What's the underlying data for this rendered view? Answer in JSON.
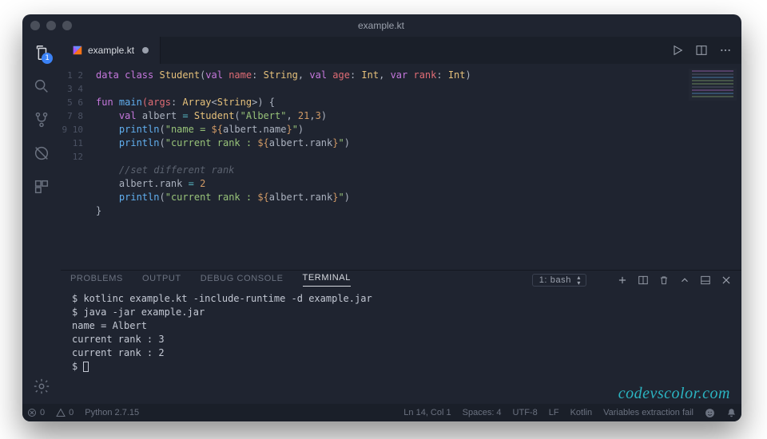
{
  "window": {
    "title": "example.kt"
  },
  "activitybar": {
    "badge": "1"
  },
  "tabs": [
    {
      "label": "example.kt",
      "dirty": true
    }
  ],
  "editor": {
    "line_start": 1,
    "lines": {
      "l1": {
        "a": "data class ",
        "b": "Student",
        "c": "(",
        "d": "val",
        "e": " name",
        "f": ": ",
        "g": "String",
        "h": ", ",
        "i": "val",
        "j": " age",
        "k": ": ",
        "l": "Int",
        "m": ", ",
        "n": "var",
        "o": " rank",
        "p": ": ",
        "q": "Int",
        "r": ")"
      },
      "l3": {
        "a": "fun ",
        "b": "main",
        "c": "(args",
        "d": ": ",
        "e": "Array",
        "f": "<",
        "g": "String",
        "h": ">) {"
      },
      "l4": {
        "ind": "    ",
        "a": "val",
        "b": " albert ",
        "c": "= ",
        "d": "Student",
        "e": "(",
        "f": "\"Albert\"",
        "g": ", ",
        "h": "21",
        "i": ",",
        "j": "3",
        "k": ")"
      },
      "l5": {
        "ind": "    ",
        "a": "println",
        "b": "(",
        "c": "\"name = ",
        "d": "${",
        "e": "albert.name",
        "f": "}",
        "g": "\"",
        "h": ")"
      },
      "l6": {
        "ind": "    ",
        "a": "println",
        "b": "(",
        "c": "\"current rank : ",
        "d": "${",
        "e": "albert.rank",
        "f": "}",
        "g": "\"",
        "h": ")"
      },
      "l8": {
        "ind": "    ",
        "a": "//set different rank"
      },
      "l9": {
        "ind": "    ",
        "a": "albert.rank ",
        "b": "= ",
        "c": "2"
      },
      "l10": {
        "ind": "    ",
        "a": "println",
        "b": "(",
        "c": "\"current rank : ",
        "d": "${",
        "e": "albert.rank",
        "f": "}",
        "g": "\"",
        "h": ")"
      },
      "l11": {
        "a": "}"
      }
    }
  },
  "panel": {
    "tabs": [
      "PROBLEMS",
      "OUTPUT",
      "DEBUG CONSOLE",
      "TERMINAL"
    ],
    "active": 3,
    "selector": "1: bash"
  },
  "terminal": {
    "l1": "$ kotlinc example.kt -include-runtime -d example.jar",
    "l2": "$ java -jar example.jar",
    "l3": "name = Albert",
    "l4": "current rank : 3",
    "l5": "current rank : 2",
    "l6": "$ "
  },
  "status": {
    "errors": "0",
    "warnings": "0",
    "python": "Python 2.7.15",
    "pos": "Ln 14, Col 1",
    "spaces": "Spaces: 4",
    "enc": "UTF-8",
    "eol": "LF",
    "lang": "Kotlin",
    "extra": "Variables extraction fail"
  },
  "watermark": "codevscolor.com"
}
